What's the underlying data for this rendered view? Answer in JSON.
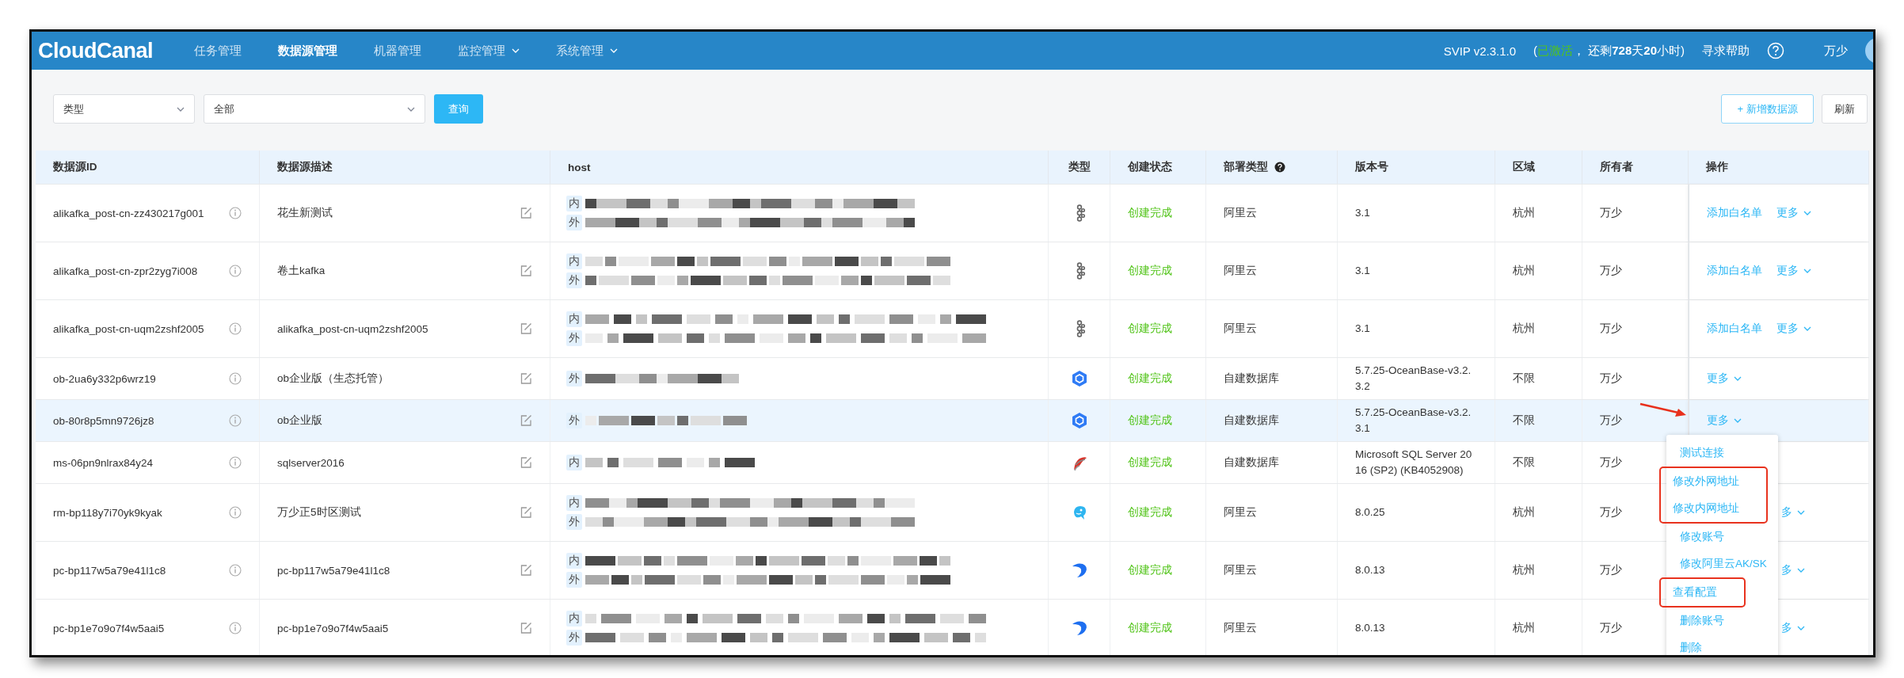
{
  "topbar": {
    "logo": "CloudCanal",
    "nav": [
      {
        "label": "任务管理",
        "selected": false,
        "dropdown": false
      },
      {
        "label": "数据源管理",
        "selected": true,
        "dropdown": false
      },
      {
        "label": "机器管理",
        "selected": false,
        "dropdown": false
      },
      {
        "label": "监控管理",
        "selected": false,
        "dropdown": true
      },
      {
        "label": "系统管理",
        "selected": false,
        "dropdown": true
      }
    ],
    "version": "SVIP v2.3.1.0",
    "license_open": "(",
    "license_status": "已激活",
    "license_rest": "， 还剩**728**天**20**小时)",
    "help": "寻求帮助",
    "user": "万少"
  },
  "filters": {
    "type_select": "类型",
    "value_select": "全部",
    "query_button": "查询",
    "add_button": "+ 新增数据源",
    "refresh_button": "刷新"
  },
  "table": {
    "columns": [
      {
        "label": "数据源ID",
        "help": false
      },
      {
        "label": "数据源描述",
        "help": false
      },
      {
        "label": "host",
        "help": false
      },
      {
        "label": "类型",
        "help": false
      },
      {
        "label": "创建状态",
        "help": false
      },
      {
        "label": "部署类型",
        "help": true
      },
      {
        "label": "版本号",
        "help": false
      },
      {
        "label": "区域",
        "help": false
      },
      {
        "label": "所有者",
        "help": false
      },
      {
        "label": "操作",
        "help": false
      }
    ],
    "rows": [
      {
        "id": "alikafka_post-cn-zz430217g001",
        "description": "花生新测试",
        "hosts": [
          {
            "tag": "内"
          },
          {
            "tag": "外"
          }
        ],
        "kind": "kafka",
        "status": "创建完成",
        "deploy": "阿里云",
        "version": "3.1",
        "region": "杭州",
        "owner": "万少",
        "selected": false,
        "covered": false,
        "actions": [
          {
            "label": "添加白名单",
            "dropdown": false
          },
          {
            "label": "更多",
            "dropdown": true
          }
        ]
      },
      {
        "id": "alikafka_post-cn-zpr2zyg7i008",
        "description": "卷土kafka",
        "hosts": [
          {
            "tag": "内"
          },
          {
            "tag": "外"
          }
        ],
        "kind": "kafka",
        "status": "创建完成",
        "deploy": "阿里云",
        "version": "3.1",
        "region": "杭州",
        "owner": "万少",
        "selected": false,
        "covered": false,
        "actions": [
          {
            "label": "添加白名单",
            "dropdown": false
          },
          {
            "label": "更多",
            "dropdown": true
          }
        ]
      },
      {
        "id": "alikafka_post-cn-uqm2zshf2005",
        "description": "alikafka_post-cn-uqm2zshf2005",
        "hosts": [
          {
            "tag": "内"
          },
          {
            "tag": "外"
          }
        ],
        "kind": "kafka",
        "status": "创建完成",
        "deploy": "阿里云",
        "version": "3.1",
        "region": "杭州",
        "owner": "万少",
        "selected": false,
        "covered": false,
        "actions": [
          {
            "label": "添加白名单",
            "dropdown": false
          },
          {
            "label": "更多",
            "dropdown": true
          }
        ]
      },
      {
        "id": "ob-2ua6y332p6wrz19",
        "description": "ob企业版（生态托管）",
        "hosts": [
          {
            "tag": "外"
          }
        ],
        "kind": "oceanbase",
        "status": "创建完成",
        "deploy": "自建数据库",
        "version": "5.7.25-OceanBase-v3.2.3.2",
        "region": "不限",
        "owner": "万少",
        "selected": false,
        "covered": false,
        "actions": [
          {
            "label": "更多",
            "dropdown": true
          }
        ]
      },
      {
        "id": "ob-80r8p5mn9726jz8",
        "description": "ob企业版",
        "hosts": [
          {
            "tag": "外"
          }
        ],
        "kind": "oceanbase",
        "status": "创建完成",
        "deploy": "自建数据库",
        "version": "5.7.25-OceanBase-v3.2.3.1",
        "region": "不限",
        "owner": "万少",
        "selected": true,
        "covered": false,
        "actions": [
          {
            "label": "更多",
            "dropdown": true
          }
        ],
        "more_menu": {
          "arrow": true,
          "groups": [
            {
              "boxed": false,
              "items": [
                "测试连接"
              ]
            },
            {
              "boxed": true,
              "items": [
                "修改外网地址",
                "修改内网地址"
              ]
            },
            {
              "boxed": false,
              "items": [
                "修改账号",
                "修改阿里云AK/SK"
              ]
            },
            {
              "boxed": true,
              "items": [
                "查看配置"
              ]
            },
            {
              "boxed": false,
              "items": [
                "删除账号",
                "删除"
              ]
            }
          ]
        }
      },
      {
        "id": "ms-06pn9nlrax84y24",
        "description": "sqlserver2016",
        "hosts": [
          {
            "tag": "内"
          }
        ],
        "kind": "sqlserver",
        "status": "创建完成",
        "deploy": "自建数据库",
        "version": "Microsoft SQL Server 2016 (SP2) (KB4052908)",
        "region": "不限",
        "owner": "万少",
        "selected": false,
        "actions": []
      },
      {
        "id": "rm-bp118y7i70yk9kyak",
        "description": "万少正5时区测试",
        "hosts": [
          {
            "tag": "内"
          },
          {
            "tag": "外"
          }
        ],
        "kind": "mysql",
        "status": "创建完成",
        "deploy": "阿里云",
        "version": "8.0.25",
        "region": "杭州",
        "owner": "万少",
        "selected": false,
        "covered": true,
        "actions": [
          {
            "label": "多",
            "dropdown": true
          }
        ]
      },
      {
        "id": "pc-bp117w5a79e41l1c8",
        "description": "pc-bp117w5a79e41l1c8",
        "hosts": [
          {
            "tag": "内"
          },
          {
            "tag": "外"
          }
        ],
        "kind": "polardb",
        "status": "创建完成",
        "deploy": "阿里云",
        "version": "8.0.13",
        "region": "杭州",
        "owner": "万少",
        "selected": false,
        "covered": true,
        "actions": [
          {
            "label": "多",
            "dropdown": true
          }
        ]
      },
      {
        "id": "pc-bp1e7o9o7f4w5aai5",
        "description": "pc-bp1e7o9o7f4w5aai5",
        "hosts": [
          {
            "tag": "内"
          },
          {
            "tag": "外"
          }
        ],
        "kind": "polardb",
        "status": "创建完成",
        "deploy": "阿里云",
        "version": "8.0.13",
        "region": "杭州",
        "owner": "万少",
        "selected": false,
        "covered": true,
        "actions": [
          {
            "label": "多",
            "dropdown": true
          }
        ]
      }
    ]
  }
}
